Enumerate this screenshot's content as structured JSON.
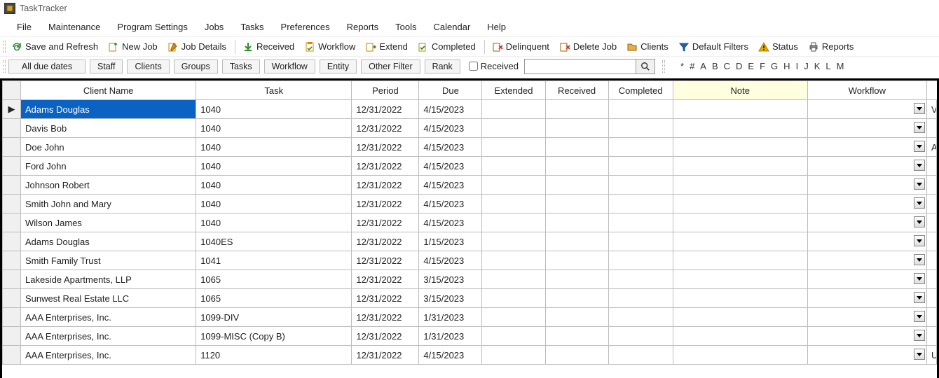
{
  "app": {
    "title": "TaskTracker"
  },
  "menu": [
    "File",
    "Maintenance",
    "Program Settings",
    "Jobs",
    "Tasks",
    "Preferences",
    "Reports",
    "Tools",
    "Calendar",
    "Help"
  ],
  "toolbar": [
    {
      "label": "Save and Refresh",
      "icon": "refresh",
      "color": "#2e8b2e"
    },
    {
      "label": "New Job",
      "icon": "newjob",
      "color": "#c08a00"
    },
    {
      "label": "Job Details",
      "icon": "edit",
      "color": "#c08a00"
    },
    {
      "sep": true
    },
    {
      "label": "Received",
      "icon": "down",
      "color": "#2e8b2e"
    },
    {
      "label": "Workflow",
      "icon": "clipboard",
      "color": "#d88a00"
    },
    {
      "label": "Extend",
      "icon": "extend",
      "color": "#c08a00"
    },
    {
      "label": "Completed",
      "icon": "complete",
      "color": "#c08a00"
    },
    {
      "sep": true
    },
    {
      "label": "Delinquent",
      "icon": "delinquent",
      "color": "#c0392b"
    },
    {
      "label": "Delete Job",
      "icon": "delete",
      "color": "#c0392b"
    },
    {
      "label": "Clients",
      "icon": "clients",
      "color": "#c08a00"
    },
    {
      "label": "Default Filters",
      "icon": "funnel",
      "color": "#2a5db0"
    },
    {
      "label": "Status",
      "icon": "warning",
      "color": "#e0a800"
    },
    {
      "label": "Reports",
      "icon": "printer",
      "color": "#555"
    }
  ],
  "filters": {
    "all_due": "All due dates",
    "buttons": [
      "Staff",
      "Clients",
      "Groups",
      "Tasks",
      "Workflow",
      "Entity",
      "Other Filter",
      "Rank"
    ],
    "received_label": "Received",
    "search_value": "",
    "alpha": [
      "*",
      "#",
      "A",
      "B",
      "C",
      "D",
      "E",
      "F",
      "G",
      "H",
      "I",
      "J",
      "K",
      "L",
      "M"
    ]
  },
  "columns": [
    "Client Name",
    "Task",
    "Period",
    "Due",
    "Extended",
    "Received",
    "Completed",
    "Note",
    "Workflow"
  ],
  "rows": [
    {
      "client": "Adams Douglas",
      "task": "1040",
      "period": "12/31/2022",
      "due": "4/15/2023",
      "edge": "V",
      "selected": true
    },
    {
      "client": "Davis Bob",
      "task": "1040",
      "period": "12/31/2022",
      "due": "4/15/2023",
      "edge": ""
    },
    {
      "client": "Doe John",
      "task": "1040",
      "period": "12/31/2022",
      "due": "4/15/2023",
      "edge": "A"
    },
    {
      "client": "Ford John",
      "task": "1040",
      "period": "12/31/2022",
      "due": "4/15/2023",
      "edge": ""
    },
    {
      "client": "Johnson Robert",
      "task": "1040",
      "period": "12/31/2022",
      "due": "4/15/2023",
      "edge": ""
    },
    {
      "client": "Smith John and Mary",
      "task": "1040",
      "period": "12/31/2022",
      "due": "4/15/2023",
      "edge": ""
    },
    {
      "client": "Wilson James",
      "task": "1040",
      "period": "12/31/2022",
      "due": "4/15/2023",
      "edge": ""
    },
    {
      "client": "Adams Douglas",
      "task": "1040ES",
      "period": "12/31/2022",
      "due": "1/15/2023",
      "edge": ""
    },
    {
      "client": "Smith Family Trust",
      "task": "1041",
      "period": "12/31/2022",
      "due": "4/15/2023",
      "edge": ""
    },
    {
      "client": "Lakeside Apartments, LLP",
      "task": "1065",
      "period": "12/31/2022",
      "due": "3/15/2023",
      "edge": ""
    },
    {
      "client": "Sunwest Real Estate LLC",
      "task": "1065",
      "period": "12/31/2022",
      "due": "3/15/2023",
      "edge": ""
    },
    {
      "client": "AAA Enterprises, Inc.",
      "task": "1099-DIV",
      "period": "12/31/2022",
      "due": "1/31/2023",
      "edge": ""
    },
    {
      "client": "AAA Enterprises, Inc.",
      "task": "1099-MISC (Copy B)",
      "period": "12/31/2022",
      "due": "1/31/2023",
      "edge": ""
    },
    {
      "client": "AAA Enterprises, Inc.",
      "task": "1120",
      "period": "12/31/2022",
      "due": "4/15/2023",
      "edge": "U"
    }
  ]
}
